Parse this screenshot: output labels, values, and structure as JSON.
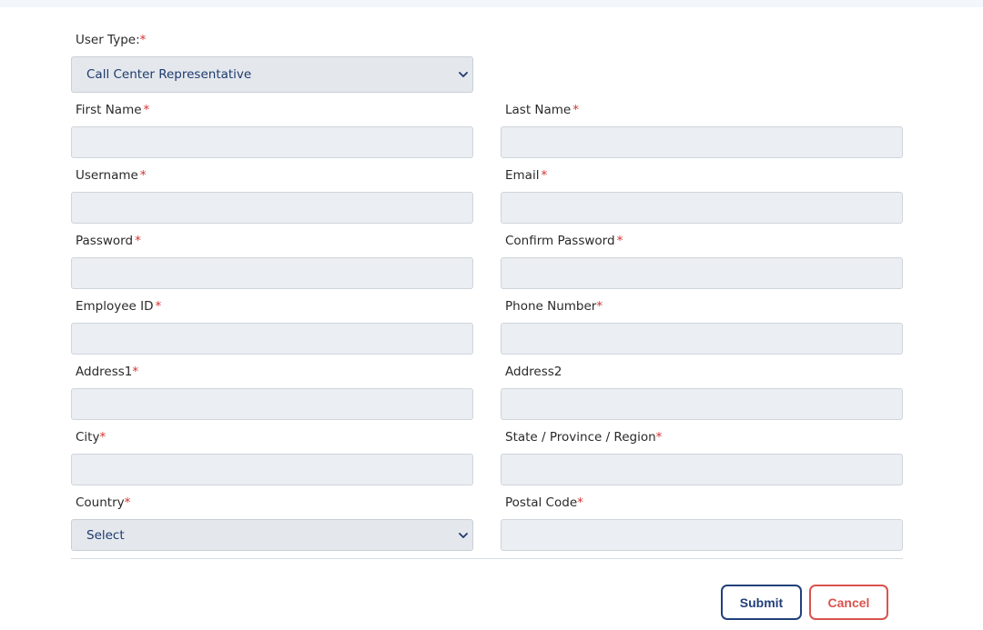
{
  "form": {
    "user_type": {
      "label": "User Type:",
      "required_mark": "*",
      "selected": "Call Center Representative"
    },
    "first_name": {
      "label": "First Name",
      "required_mark": "*"
    },
    "last_name": {
      "label": "Last Name",
      "required_mark": "*"
    },
    "username": {
      "label": "Username",
      "required_mark": "*"
    },
    "email": {
      "label": "Email",
      "required_mark": "*"
    },
    "password": {
      "label": "Password",
      "required_mark": "*"
    },
    "confirm_password": {
      "label": "Confirm Password",
      "required_mark": "*"
    },
    "employee_id": {
      "label": "Employee ID",
      "required_mark": "*"
    },
    "phone_number": {
      "label": "Phone Number",
      "required_mark": "*"
    },
    "address1": {
      "label": "Address1",
      "required_mark": "*"
    },
    "address2": {
      "label": "Address2"
    },
    "city": {
      "label": "City",
      "required_mark": "*"
    },
    "state": {
      "label": "State / Province / Region",
      "required_mark": "*"
    },
    "country": {
      "label": "Country",
      "required_mark": "*",
      "selected": "Select"
    },
    "postal_code": {
      "label": "Postal Code",
      "required_mark": "*"
    }
  },
  "actions": {
    "submit_label": "Submit",
    "cancel_label": "Cancel"
  },
  "colors": {
    "required": "#d3332f",
    "primary": "#22407a",
    "danger": "#d9534f",
    "input_bg": "#ebeef2"
  },
  "icons": {
    "select_chevron": "chevron-down-icon"
  }
}
